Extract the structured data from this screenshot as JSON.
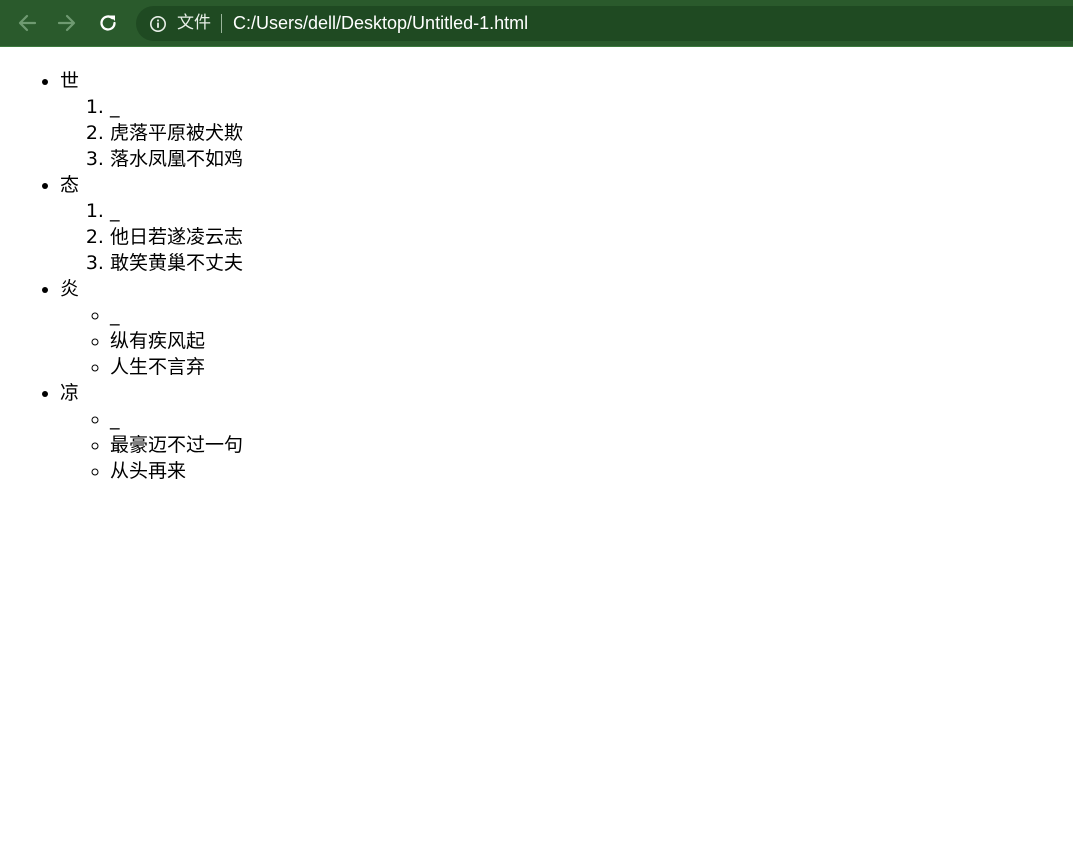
{
  "browser": {
    "back_icon": "arrow-left-icon",
    "forward_icon": "arrow-right-icon",
    "reload_icon": "reload-icon",
    "info_icon": "info-circle-icon",
    "scheme_label": "文件",
    "url": "C:/Users/dell/Desktop/Untitled-1.html",
    "toolbar_color": "#2a5a2c",
    "omnibox_color": "#1f4a22"
  },
  "content": {
    "sections": [
      {
        "heading": "世",
        "items": [
          "_",
          "虎落平原被犬欺",
          "落水凤凰不如鸡"
        ]
      },
      {
        "heading": "态",
        "items": [
          "_",
          "他日若遂凌云志",
          "敢笑黄巢不丈夫"
        ]
      },
      {
        "heading": "炎",
        "items": [
          "_",
          "纵有疾风起",
          "人生不言弃"
        ]
      },
      {
        "heading": "凉",
        "items": [
          "_",
          "最豪迈不过一句",
          "从头再来"
        ]
      }
    ]
  }
}
